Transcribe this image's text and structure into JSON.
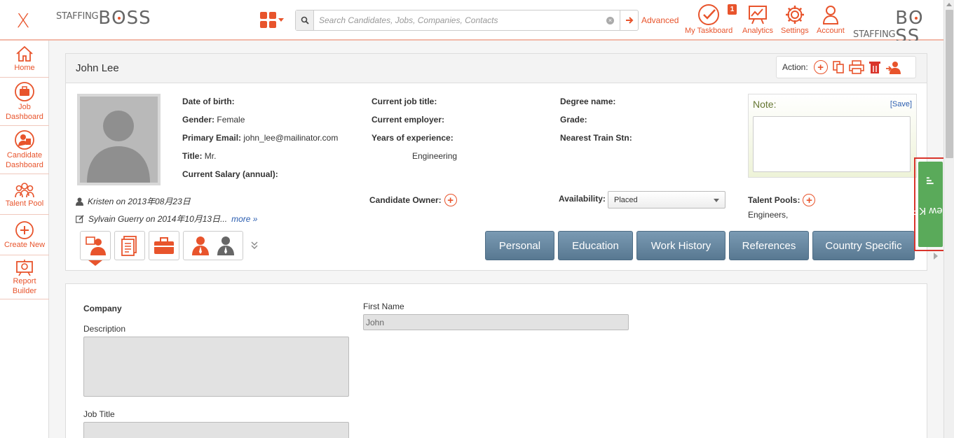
{
  "app": {
    "close_label": "X",
    "logo_left": {
      "part1": "STAFFING",
      "part2_pre": "B",
      "part2_o": "O",
      "part2_post": "SS"
    },
    "logo_right": {
      "part1": "STAFFING",
      "part2_pre": "B",
      "part2_o": "O",
      "part2_post": "SS"
    }
  },
  "search": {
    "placeholder": "Search Candidates, Jobs, Companies, Contacts",
    "advanced_label": "Advanced"
  },
  "topnav": {
    "taskboard": {
      "label": "My Taskboard",
      "badge": "1"
    },
    "analytics": {
      "label": "Analytics"
    },
    "settings": {
      "label": "Settings"
    },
    "account": {
      "label": "Account"
    }
  },
  "sidebar": {
    "items": [
      {
        "label": "Home",
        "icon": "home-icon"
      },
      {
        "label": "Job Dashboard",
        "icon": "briefcase-icon"
      },
      {
        "label": "Candidate Dashboard",
        "icon": "candidate-icon"
      },
      {
        "label": "Talent Pool",
        "icon": "people-icon"
      },
      {
        "label": "Create New",
        "icon": "plus-circle-icon"
      },
      {
        "label": "Report Builder",
        "icon": "report-icon"
      }
    ]
  },
  "candidate": {
    "name": "John Lee",
    "action_label": "Action:",
    "fields": {
      "dob_label": "Date of birth:",
      "dob_value": "",
      "gender_label": "Gender:",
      "gender_value": "Female",
      "email_label": "Primary Email:",
      "email_value": "john_lee@mailinator.com",
      "title_label": "Title:",
      "title_value": "Mr.",
      "salary_label": "Current Salary (annual):",
      "salary_value": "",
      "job_title_label": "Current job title:",
      "employer_label": "Current employer:",
      "experience_label": "Years of experience:",
      "industry_value": "Engineering",
      "degree_label": "Degree name:",
      "grade_label": "Grade:",
      "train_label": "Nearest Train Stn:"
    },
    "created": "Kristen on 2013年08月23日",
    "modified": "Sylvain Guerry on 2014年10月13日...",
    "more_label": "more »",
    "owner_label": "Candidate Owner:",
    "availability_label": "Availability:",
    "availability_value": "Placed",
    "talent_pools_label": "Talent Pools:",
    "talent_pools_value": "Engineers,",
    "note_label": "Note:",
    "note_save": "[Save]"
  },
  "tabs": [
    "Personal",
    "Education",
    "Work History",
    "References",
    "Country Specific"
  ],
  "form": {
    "company_label": "Company",
    "description_label": "Description",
    "job_title_label": "Job Title",
    "first_name_label": "First Name",
    "first_name_value": "John"
  },
  "kpi": {
    "label": "View KPI"
  },
  "colors": {
    "accent": "#e8542c",
    "tab": "#587891",
    "kpi": "#5aaa5a"
  }
}
